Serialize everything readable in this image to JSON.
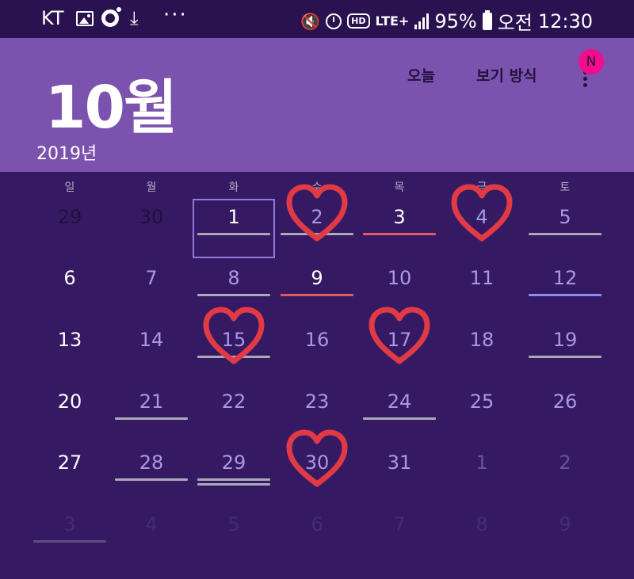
{
  "status_bar": {
    "carrier": "KT",
    "battery": "95%",
    "ampm": "오전",
    "time": "12:30",
    "hd": "HD",
    "lte": "LTE+",
    "more_dots": "···",
    "download": "⤓",
    "mute": "🔇"
  },
  "header": {
    "month": "10월",
    "year": "2019년",
    "today_label": "오늘",
    "view_label": "보기 방식",
    "badge": "N"
  },
  "colors": {
    "background": "#351a63",
    "header": "#7b52ad",
    "in_month_text": "#a997e6",
    "bar_gray": "#a9a9b7",
    "bar_red": "#e05a66",
    "bar_blue": "#8b8ef2",
    "heart": "#e03a45"
  },
  "calendar": {
    "weekdays": [
      "일",
      "월",
      "화",
      "수",
      "목",
      "금",
      "토"
    ],
    "weeks": [
      [
        "29",
        "30",
        "1",
        "2",
        "3",
        "4",
        "5"
      ],
      [
        "6",
        "7",
        "8",
        "9",
        "10",
        "11",
        "12"
      ],
      [
        "13",
        "14",
        "15",
        "16",
        "17",
        "18",
        "19"
      ],
      [
        "20",
        "21",
        "22",
        "23",
        "24",
        "25",
        "26"
      ],
      [
        "27",
        "28",
        "29",
        "30",
        "31",
        "1",
        "2"
      ],
      [
        "3",
        "4",
        "5",
        "6",
        "7",
        "8",
        "9"
      ]
    ],
    "selected_day": "1",
    "event_bars": [
      {
        "week": 0,
        "day": 2,
        "color": "gray",
        "count": 1
      },
      {
        "week": 0,
        "day": 3,
        "color": "gray",
        "count": 1
      },
      {
        "week": 0,
        "day": 4,
        "color": "red",
        "count": 1
      },
      {
        "week": 0,
        "day": 6,
        "color": "gray",
        "count": 1
      },
      {
        "week": 1,
        "day": 2,
        "color": "gray",
        "count": 1
      },
      {
        "week": 1,
        "day": 3,
        "color": "red",
        "count": 1
      },
      {
        "week": 1,
        "day": 6,
        "color": "blue",
        "count": 1
      },
      {
        "week": 2,
        "day": 2,
        "color": "gray",
        "count": 1
      },
      {
        "week": 2,
        "day": 6,
        "color": "gray",
        "count": 1
      },
      {
        "week": 3,
        "day": 1,
        "color": "gray",
        "count": 1
      },
      {
        "week": 3,
        "day": 4,
        "color": "gray",
        "count": 1
      },
      {
        "week": 4,
        "day": 1,
        "color": "gray",
        "count": 1
      },
      {
        "week": 4,
        "day": 2,
        "color": "gray",
        "count": 2
      },
      {
        "week": 5,
        "day": 0,
        "color": "dark",
        "count": 1
      }
    ],
    "hearts": [
      {
        "week": 0,
        "day": 3
      },
      {
        "week": 0,
        "day": 5
      },
      {
        "week": 2,
        "day": 2
      },
      {
        "week": 2,
        "day": 4
      },
      {
        "week": 4,
        "day": 3
      }
    ]
  }
}
